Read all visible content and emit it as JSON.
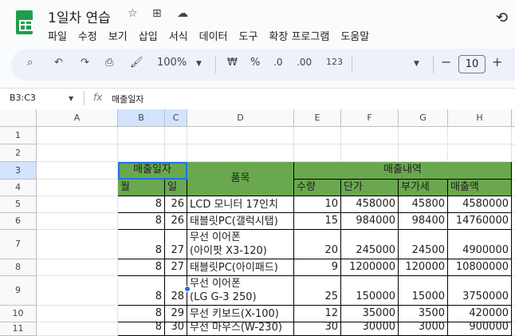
{
  "app": {
    "title": "1일차 연습",
    "menu": [
      "파일",
      "수정",
      "보기",
      "삽입",
      "서식",
      "데이터",
      "도구",
      "확장 프로그램",
      "도움말"
    ]
  },
  "toolbar": {
    "zoom": "100%",
    "currency": "₩",
    "percent": "%",
    "dec_decrease": ".0",
    "dec_increase": ".00",
    "format_123": "123",
    "font_size": "10"
  },
  "formula_bar": {
    "name_box": "B3:C3",
    "fx": "fx",
    "content": "매출일자"
  },
  "columns": [
    "A",
    "B",
    "C",
    "D",
    "E",
    "F",
    "G",
    "H"
  ],
  "rows": [
    "1",
    "2",
    "3",
    "4",
    "5",
    "6",
    "7",
    "8",
    "9",
    "10",
    "11"
  ],
  "sheet": {
    "header": {
      "date": "매출일자",
      "item": "품목",
      "sales": "매출내역",
      "month": "월",
      "day": "일",
      "qty": "수량",
      "price": "단가",
      "vat": "부가세",
      "amount": "매출액"
    },
    "records": [
      {
        "m": "8",
        "d": "26",
        "item": "LCD 모니터 17인치",
        "qty": "10",
        "price": "458000",
        "vat": "45800",
        "amount": "4580000"
      },
      {
        "m": "8",
        "d": "26",
        "item": "태블릿PC(갤럭시탭)",
        "qty": "15",
        "price": "984000",
        "vat": "98400",
        "amount": "14760000"
      },
      {
        "m": "8",
        "d": "27",
        "item": "무선 이어폰\n(아이팟 X3-120)",
        "qty": "20",
        "price": "245000",
        "vat": "24500",
        "amount": "4900000"
      },
      {
        "m": "8",
        "d": "27",
        "item": "태블릿PC(아이패드)",
        "qty": "9",
        "price": "1200000",
        "vat": "120000",
        "amount": "10800000"
      },
      {
        "m": "8",
        "d": "28",
        "item": "무선 이어폰\n(LG G-3 250)",
        "qty": "25",
        "price": "150000",
        "vat": "15000",
        "amount": "3750000"
      },
      {
        "m": "8",
        "d": "29",
        "item": "무선 키보드(X-100)",
        "qty": "12",
        "price": "35000",
        "vat": "3500",
        "amount": "420000"
      },
      {
        "m": "8",
        "d": "30",
        "item": "무선 마우스(W-230)",
        "qty": "30",
        "price": "30000",
        "vat": "3000",
        "amount": "900000"
      }
    ]
  }
}
